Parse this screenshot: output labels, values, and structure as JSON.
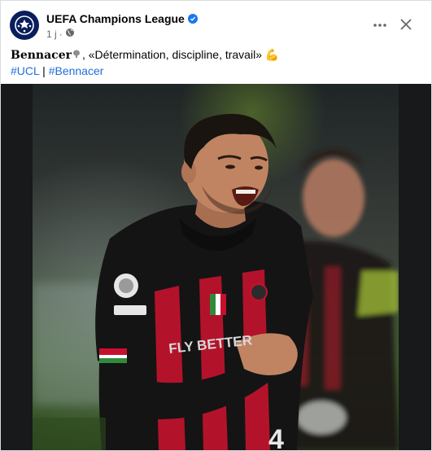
{
  "post": {
    "page_name": "UEFA Champions League",
    "verified": true,
    "time": "1 j",
    "privacy_icon": "globe-icon",
    "caption": {
      "player": "Bennacer",
      "quote": ", «Détermination, discipline, travail»",
      "emoji": "💪"
    },
    "hashtags": [
      "#UCL",
      "#Bennacer"
    ],
    "separator": "|"
  },
  "photo": {
    "kit_sponsor": "FLY BETTER",
    "shirt_number": "4"
  },
  "colors": {
    "link": "#216fdb",
    "verified": "#1877f2",
    "shirt_red": "#b3132a",
    "shirt_black": "#141414"
  }
}
